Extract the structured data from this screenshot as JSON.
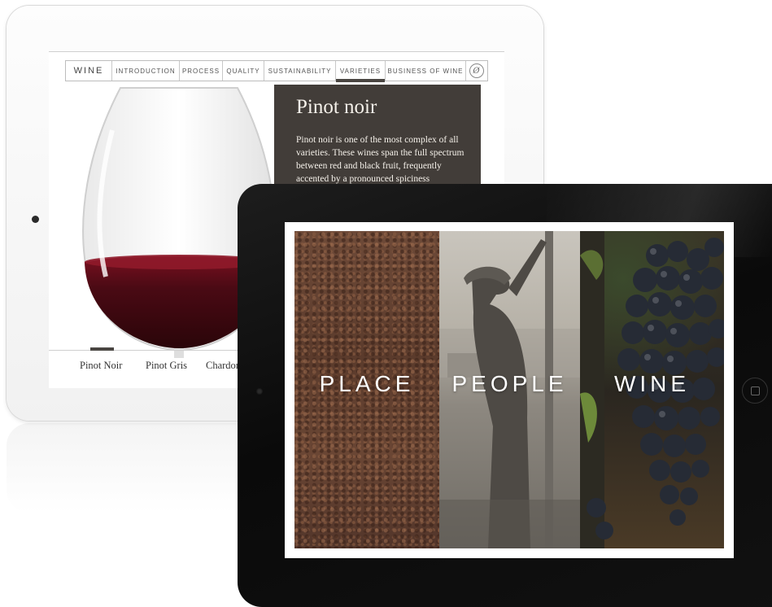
{
  "white_ipad": {
    "nav": {
      "brand": "WINE",
      "items": [
        "INTRODUCTION",
        "PROCESS",
        "QUALITY",
        "SUSTAINABILITY",
        "VARIETIES",
        "BUSINESS OF WINE"
      ],
      "active": "VARIETIES",
      "logo_glyph": "Ø"
    },
    "panel": {
      "title": "Pinot noir",
      "text": "Pinot noir is one of the most complex of all varieties. These wines span the full spectrum between red and black fruit, frequently accented by a pronounced spiciness"
    },
    "varieties": [
      "Pinot Noir",
      "Pinot Gris",
      "Chardon"
    ],
    "active_variety": "Pinot Noir"
  },
  "black_ipad": {
    "panels": [
      "PLACE",
      "PEOPLE",
      "WINE"
    ]
  },
  "colors": {
    "panel_bg": "#423d39",
    "accent_bar": "#4a4642",
    "wine": "#5a0f1a"
  }
}
